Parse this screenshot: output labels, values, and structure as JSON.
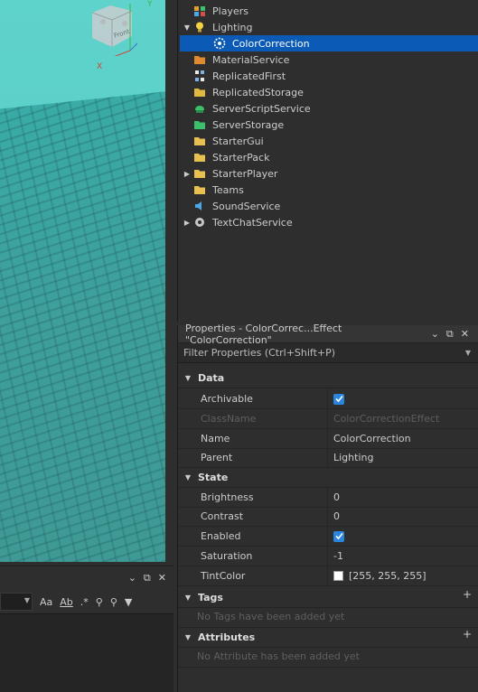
{
  "explorer": {
    "items": [
      {
        "label": "Players",
        "icon": "players-icon",
        "arrow": "",
        "indent": 0
      },
      {
        "label": "Lighting",
        "icon": "lighting-icon",
        "arrow": "▼",
        "indent": 0
      },
      {
        "label": "ColorCorrection",
        "icon": "color-correction-icon",
        "arrow": "",
        "indent": 1,
        "selected": true
      },
      {
        "label": "MaterialService",
        "icon": "material-service-icon",
        "arrow": "",
        "indent": 0
      },
      {
        "label": "ReplicatedFirst",
        "icon": "replicated-first-icon",
        "arrow": "",
        "indent": 0
      },
      {
        "label": "ReplicatedStorage",
        "icon": "replicated-storage-icon",
        "arrow": "",
        "indent": 0
      },
      {
        "label": "ServerScriptService",
        "icon": "server-script-service-icon",
        "arrow": "",
        "indent": 0
      },
      {
        "label": "ServerStorage",
        "icon": "server-storage-icon",
        "arrow": "",
        "indent": 0
      },
      {
        "label": "StarterGui",
        "icon": "starter-gui-icon",
        "arrow": "",
        "indent": 0
      },
      {
        "label": "StarterPack",
        "icon": "starter-pack-icon",
        "arrow": "",
        "indent": 0
      },
      {
        "label": "StarterPlayer",
        "icon": "starter-player-icon",
        "arrow": "▶",
        "indent": 0
      },
      {
        "label": "Teams",
        "icon": "teams-icon",
        "arrow": "",
        "indent": 0
      },
      {
        "label": "SoundService",
        "icon": "sound-service-icon",
        "arrow": "",
        "indent": 0
      },
      {
        "label": "TextChatService",
        "icon": "text-chat-service-icon",
        "arrow": "▶",
        "indent": 0
      }
    ]
  },
  "properties": {
    "title": "Properties - ColorCorrec...Effect \"ColorCorrection\"",
    "filter_placeholder": "Filter Properties (Ctrl+Shift+P)",
    "sections": {
      "data": "Data",
      "state": "State",
      "tags": "Tags",
      "attributes": "Attributes"
    },
    "rows": {
      "archivable": {
        "name": "Archivable",
        "checked": true
      },
      "classname": {
        "name": "ClassName",
        "value": "ColorCorrectionEffect"
      },
      "name": {
        "name": "Name",
        "value": "ColorCorrection"
      },
      "parent": {
        "name": "Parent",
        "value": "Lighting"
      },
      "brightness": {
        "name": "Brightness",
        "value": "0"
      },
      "contrast": {
        "name": "Contrast",
        "value": "0"
      },
      "enabled": {
        "name": "Enabled",
        "checked": true
      },
      "saturation": {
        "name": "Saturation",
        "value": "-1"
      },
      "tintcolor": {
        "name": "TintColor",
        "value": "[255, 255, 255]",
        "color": "#ffffff"
      }
    },
    "tags_empty": "No Tags have been added yet",
    "attributes_empty": "No Attribute has been added yet"
  },
  "viewport": {
    "cube_label": "Front",
    "axis_x": "X",
    "axis_y": "Y"
  },
  "output": {
    "tool_aa": "Aa",
    "tool_ab": "Ab",
    "tool_regex": ".*"
  },
  "colors": {
    "selection": "#0b5ab5",
    "checkbox": "#2b86e0",
    "sky": "#5ed3cb",
    "baseplate": "#3e9f9b"
  }
}
